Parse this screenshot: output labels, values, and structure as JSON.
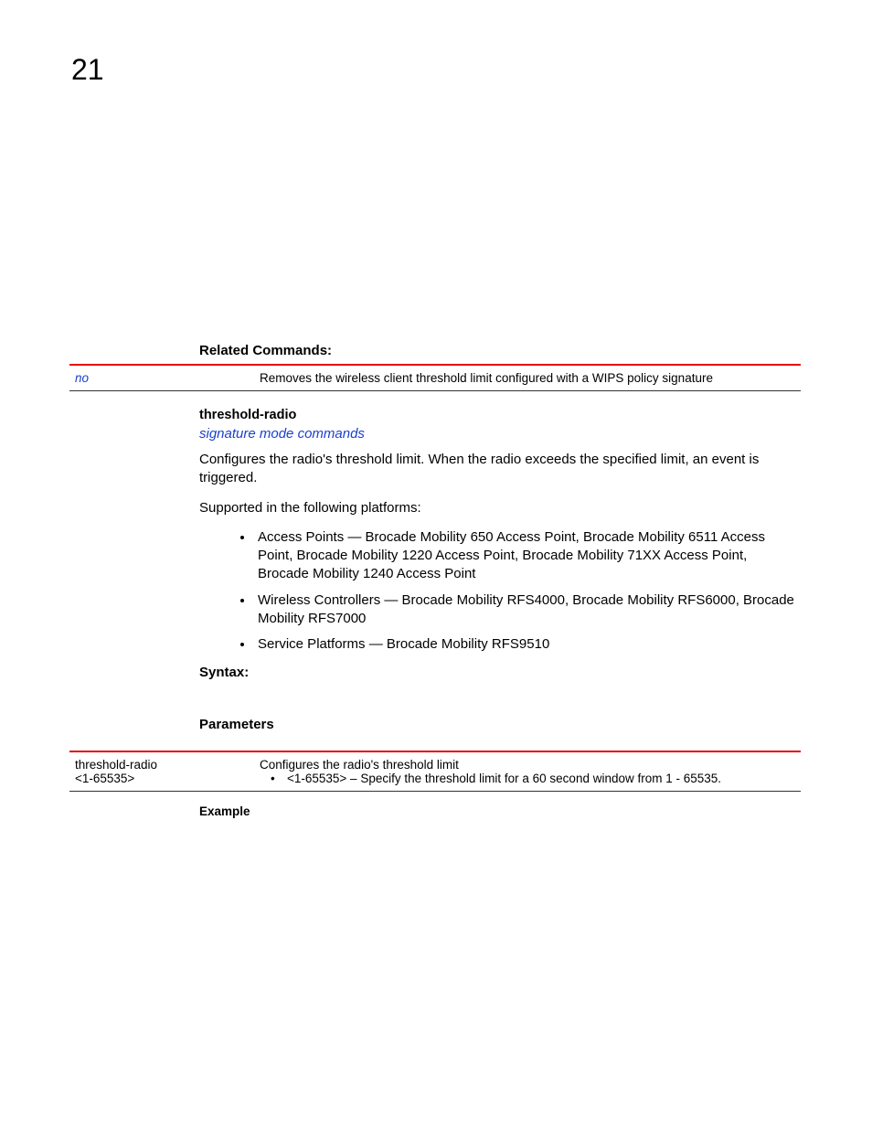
{
  "chapter_number": "21",
  "related_commands": {
    "heading": "Related Commands:",
    "row_cmd": "no",
    "row_desc": "Removes the wireless client threshold limit configured with a WIPS policy signature"
  },
  "command": {
    "name": "threshold-radio",
    "mode_link": "signature mode commands",
    "description": "Configures the radio's threshold limit. When the radio exceeds the specified limit, an event is triggered.",
    "supported_intro": "Supported in the following platforms:",
    "platforms": [
      "Access Points — Brocade Mobility 650 Access Point, Brocade Mobility 6511 Access Point, Brocade Mobility 1220 Access Point, Brocade Mobility 71XX Access Point, Brocade Mobility 1240 Access Point",
      "Wireless Controllers — Brocade Mobility RFS4000, Brocade Mobility RFS6000, Brocade Mobility RFS7000",
      "Service Platforms — Brocade Mobility RFS9510"
    ],
    "syntax_heading": "Syntax:",
    "parameters_heading": "Parameters",
    "param_row": {
      "left_line1": "threshold-radio",
      "left_line2": "<1-65535>",
      "right_line1": "Configures the radio's threshold limit",
      "right_line2": "<1-65535> – Specify the threshold limit for a 60 second window from 1 - 65535."
    },
    "example_heading": "Example"
  }
}
